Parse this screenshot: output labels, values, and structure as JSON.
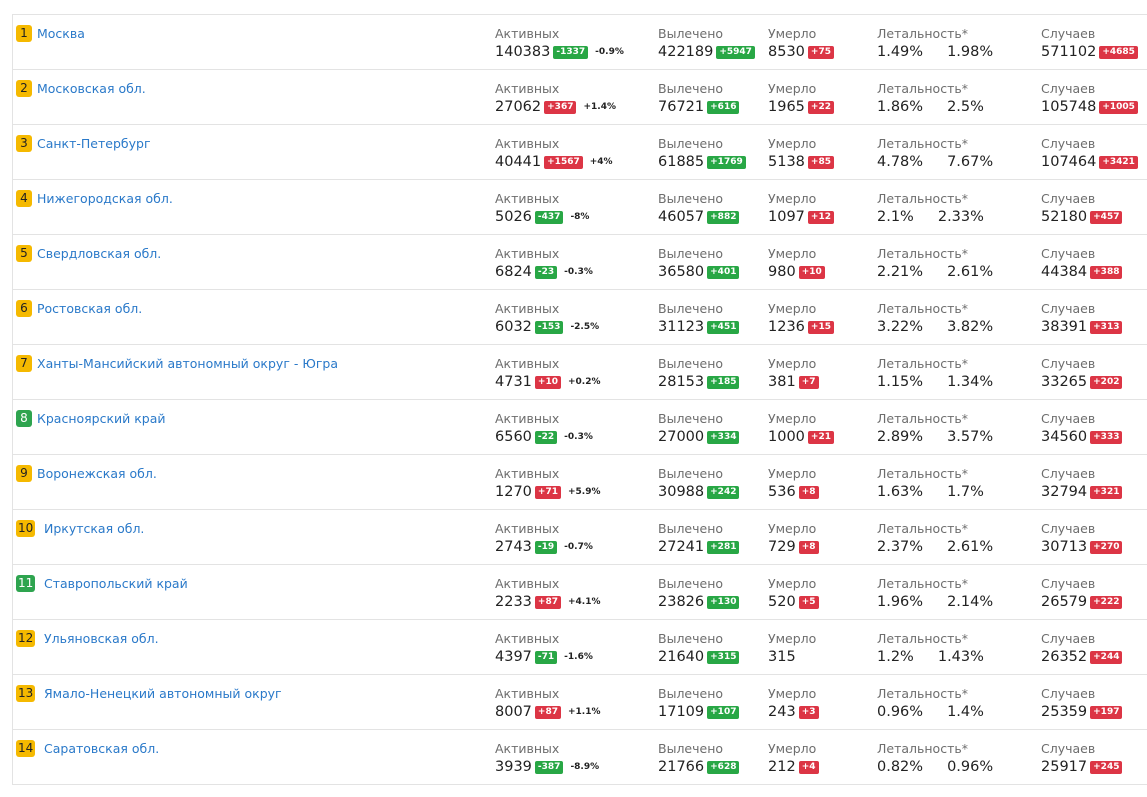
{
  "colors": {
    "link": "#2a79c9",
    "rank_yellow": "#f5b900",
    "rank_green": "#2ea44f",
    "delta_red": "#dc3545",
    "delta_green": "#28a745"
  },
  "labels": {
    "active": "Активных",
    "recovered": "Вылечено",
    "died": "Умерло",
    "lethality": "Летальность*",
    "cases": "Случаев"
  },
  "rows": [
    {
      "rank": "1",
      "rank_color": "yellow",
      "region": "Москва",
      "active": "140383",
      "active_delta": "-1337",
      "active_delta_color": "green",
      "active_pct": "-0.9%",
      "recovered": "422189",
      "recovered_delta": "+5947",
      "died": "8530",
      "died_delta": "+75",
      "leth1": "1.49%",
      "leth2": "1.98%",
      "cases": "571102",
      "cases_delta": "+4685"
    },
    {
      "rank": "2",
      "rank_color": "yellow",
      "region": "Московская обл.",
      "active": "27062",
      "active_delta": "+367",
      "active_delta_color": "red",
      "active_pct": "+1.4%",
      "recovered": "76721",
      "recovered_delta": "+616",
      "died": "1965",
      "died_delta": "+22",
      "leth1": "1.86%",
      "leth2": "2.5%",
      "cases": "105748",
      "cases_delta": "+1005"
    },
    {
      "rank": "3",
      "rank_color": "yellow",
      "region": "Санкт-Петербург",
      "active": "40441",
      "active_delta": "+1567",
      "active_delta_color": "red",
      "active_pct": "+4%",
      "recovered": "61885",
      "recovered_delta": "+1769",
      "died": "5138",
      "died_delta": "+85",
      "leth1": "4.78%",
      "leth2": "7.67%",
      "cases": "107464",
      "cases_delta": "+3421"
    },
    {
      "rank": "4",
      "rank_color": "yellow",
      "region": "Нижегородская обл.",
      "active": "5026",
      "active_delta": "-437",
      "active_delta_color": "green",
      "active_pct": "-8%",
      "recovered": "46057",
      "recovered_delta": "+882",
      "died": "1097",
      "died_delta": "+12",
      "leth1": "2.1%",
      "leth2": "2.33%",
      "cases": "52180",
      "cases_delta": "+457"
    },
    {
      "rank": "5",
      "rank_color": "yellow",
      "region": "Свердловская обл.",
      "active": "6824",
      "active_delta": "-23",
      "active_delta_color": "green",
      "active_pct": "-0.3%",
      "recovered": "36580",
      "recovered_delta": "+401",
      "died": "980",
      "died_delta": "+10",
      "leth1": "2.21%",
      "leth2": "2.61%",
      "cases": "44384",
      "cases_delta": "+388"
    },
    {
      "rank": "6",
      "rank_color": "yellow",
      "region": "Ростовская обл.",
      "active": "6032",
      "active_delta": "-153",
      "active_delta_color": "green",
      "active_pct": "-2.5%",
      "recovered": "31123",
      "recovered_delta": "+451",
      "died": "1236",
      "died_delta": "+15",
      "leth1": "3.22%",
      "leth2": "3.82%",
      "cases": "38391",
      "cases_delta": "+313"
    },
    {
      "rank": "7",
      "rank_color": "yellow",
      "region": "Ханты-Мансийский автономный округ - Югра",
      "active": "4731",
      "active_delta": "+10",
      "active_delta_color": "red",
      "active_pct": "+0.2%",
      "recovered": "28153",
      "recovered_delta": "+185",
      "died": "381",
      "died_delta": "+7",
      "leth1": "1.15%",
      "leth2": "1.34%",
      "cases": "33265",
      "cases_delta": "+202"
    },
    {
      "rank": "8",
      "rank_color": "green",
      "region": "Красноярский край",
      "active": "6560",
      "active_delta": "-22",
      "active_delta_color": "green",
      "active_pct": "-0.3%",
      "recovered": "27000",
      "recovered_delta": "+334",
      "died": "1000",
      "died_delta": "+21",
      "leth1": "2.89%",
      "leth2": "3.57%",
      "cases": "34560",
      "cases_delta": "+333"
    },
    {
      "rank": "9",
      "rank_color": "yellow",
      "region": "Воронежская обл.",
      "active": "1270",
      "active_delta": "+71",
      "active_delta_color": "red",
      "active_pct": "+5.9%",
      "recovered": "30988",
      "recovered_delta": "+242",
      "died": "536",
      "died_delta": "+8",
      "leth1": "1.63%",
      "leth2": "1.7%",
      "cases": "32794",
      "cases_delta": "+321"
    },
    {
      "rank": "10",
      "rank_color": "yellow",
      "region": "Иркутская обл.",
      "active": "2743",
      "active_delta": "-19",
      "active_delta_color": "green",
      "active_pct": "-0.7%",
      "recovered": "27241",
      "recovered_delta": "+281",
      "died": "729",
      "died_delta": "+8",
      "leth1": "2.37%",
      "leth2": "2.61%",
      "cases": "30713",
      "cases_delta": "+270"
    },
    {
      "rank": "11",
      "rank_color": "green",
      "region": "Ставропольский край",
      "active": "2233",
      "active_delta": "+87",
      "active_delta_color": "red",
      "active_pct": "+4.1%",
      "recovered": "23826",
      "recovered_delta": "+130",
      "died": "520",
      "died_delta": "+5",
      "leth1": "1.96%",
      "leth2": "2.14%",
      "cases": "26579",
      "cases_delta": "+222"
    },
    {
      "rank": "12",
      "rank_color": "yellow",
      "region": "Ульяновская обл.",
      "active": "4397",
      "active_delta": "-71",
      "active_delta_color": "green",
      "active_pct": "-1.6%",
      "recovered": "21640",
      "recovered_delta": "+315",
      "died": "315",
      "died_delta": "",
      "leth1": "1.2%",
      "leth2": "1.43%",
      "cases": "26352",
      "cases_delta": "+244"
    },
    {
      "rank": "13",
      "rank_color": "yellow",
      "region": "Ямало-Ненецкий автономный округ",
      "active": "8007",
      "active_delta": "+87",
      "active_delta_color": "red",
      "active_pct": "+1.1%",
      "recovered": "17109",
      "recovered_delta": "+107",
      "died": "243",
      "died_delta": "+3",
      "leth1": "0.96%",
      "leth2": "1.4%",
      "cases": "25359",
      "cases_delta": "+197"
    },
    {
      "rank": "14",
      "rank_color": "yellow",
      "region": "Саратовская обл.",
      "active": "3939",
      "active_delta": "-387",
      "active_delta_color": "green",
      "active_pct": "-8.9%",
      "recovered": "21766",
      "recovered_delta": "+628",
      "died": "212",
      "died_delta": "+4",
      "leth1": "0.82%",
      "leth2": "0.96%",
      "cases": "25917",
      "cases_delta": "+245"
    }
  ]
}
